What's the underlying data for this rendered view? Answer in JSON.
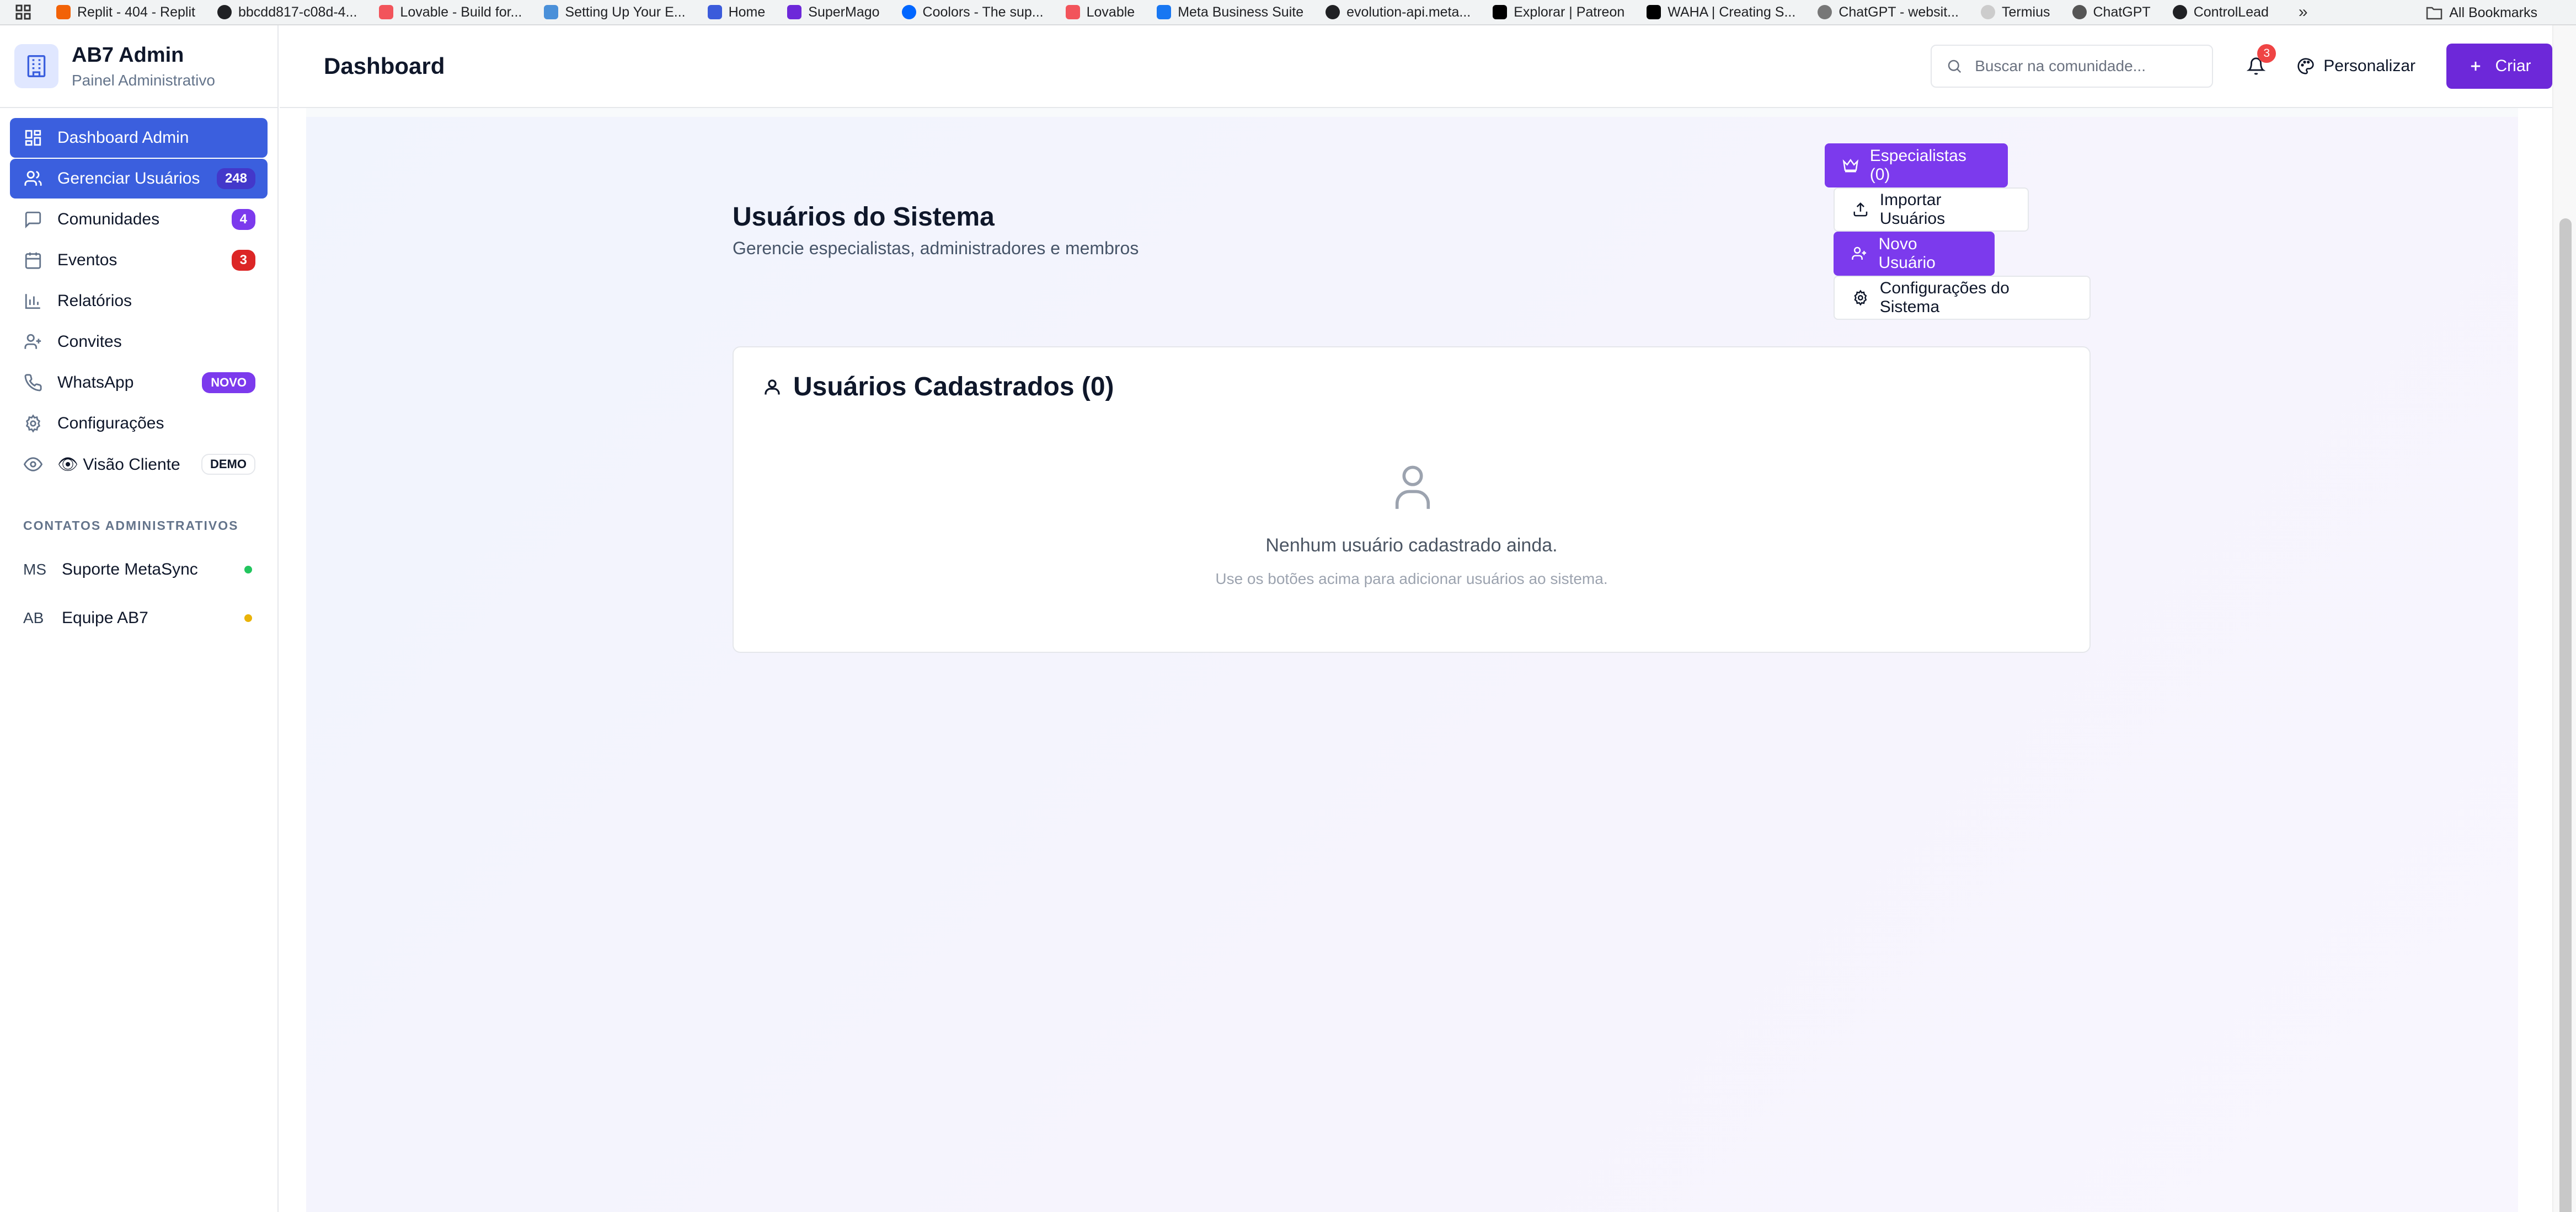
{
  "bookmarks": {
    "items": [
      {
        "label": "Replit - 404 - Replit",
        "color": "#f26207"
      },
      {
        "label": "bbcdd817-c08d-4...",
        "color": "#202124"
      },
      {
        "label": "Lovable - Build for...",
        "color": "#f2545b"
      },
      {
        "label": "Setting Up Your E...",
        "color": "#4a90d9"
      },
      {
        "label": "Home",
        "color": "#3b5bdb"
      },
      {
        "label": "SuperMago",
        "color": "#6d28d9"
      },
      {
        "label": "Coolors - The sup...",
        "color": "#0066ff"
      },
      {
        "label": "Lovable",
        "color": "#f2545b"
      },
      {
        "label": "Meta Business Suite",
        "color": "#1877f2"
      },
      {
        "label": "evolution-api.meta...",
        "color": "#202124"
      },
      {
        "label": "Explorar | Patreon",
        "color": "#000000"
      },
      {
        "label": "WAHA | Creating S...",
        "color": "#000000"
      },
      {
        "label": "ChatGPT - websit...",
        "color": "#777777"
      },
      {
        "label": "Termius",
        "color": "#cccccc"
      },
      {
        "label": "ChatGPT",
        "color": "#555555"
      },
      {
        "label": "ControlLead",
        "color": "#202124"
      }
    ],
    "more": "»",
    "all_label": "All Bookmarks"
  },
  "sidebar": {
    "brand_title": "AB7 Admin",
    "brand_subtitle": "Painel Administrativo",
    "items": [
      {
        "label": "Dashboard Admin",
        "icon": "dashboard-grid-icon",
        "active": true
      },
      {
        "label": "Gerenciar Usuários",
        "icon": "users-icon",
        "active": true,
        "badge": "248"
      },
      {
        "label": "Comunidades",
        "icon": "message-icon",
        "badge": "4"
      },
      {
        "label": "Eventos",
        "icon": "calendar-icon",
        "badge": "3"
      },
      {
        "label": "Relatórios",
        "icon": "bar-chart-icon"
      },
      {
        "label": "Convites",
        "icon": "user-plus-icon"
      },
      {
        "label": "WhatsApp",
        "icon": "phone-icon",
        "badge": "NOVO"
      },
      {
        "label": "Configurações",
        "icon": "gear-icon"
      },
      {
        "label": "👁 Visão Cliente",
        "icon": "eye-icon",
        "badge": "DEMO"
      }
    ],
    "contacts_title": "CONTATOS ADMINISTRATIVOS",
    "contacts": [
      {
        "initials": "MS",
        "name": "Suporte MetaSync",
        "status_color": "#22c55e"
      },
      {
        "initials": "AB",
        "name": "Equipe AB7",
        "status_color": "#eab308"
      }
    ]
  },
  "header": {
    "title": "Dashboard",
    "search_placeholder": "Buscar na comunidade...",
    "notification_count": "3",
    "personalize_label": "Personalizar",
    "create_label": "Criar"
  },
  "main": {
    "title": "Usuários do Sistema",
    "subtitle": "Gerencie especialistas, administradores e membros",
    "buttons": {
      "specialists": "Especialistas (0)",
      "import": "Importar Usuários",
      "new_user": "Novo Usuário",
      "settings": "Configurações do Sistema"
    },
    "card": {
      "title": "Usuários Cadastrados (0)",
      "empty_title": "Nenhum usuário cadastrado ainda.",
      "empty_subtitle": "Use os botões acima para adicionar usuários ao sistema."
    }
  },
  "colors": {
    "accent_blue": "#3b5fde",
    "accent_purple": "#7c3aed",
    "danger": "#dc2626"
  }
}
